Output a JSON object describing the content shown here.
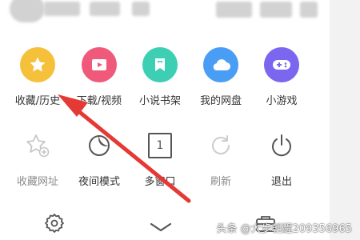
{
  "colors": {
    "favorites": "#f5c03a",
    "downloads": "#f05a7a",
    "novels": "#3ccfb4",
    "netdisk": "#4a9df5",
    "games": "#7b66f0",
    "annotation_arrow": "#e53935"
  },
  "menu": {
    "row1": [
      {
        "label": "收藏/历史",
        "icon": "star-icon"
      },
      {
        "label": "下载/视频",
        "icon": "download-video-icon"
      },
      {
        "label": "小说书架",
        "icon": "bookmark-book-icon"
      },
      {
        "label": "我的网盘",
        "icon": "cloud-icon"
      },
      {
        "label": "小游戏",
        "icon": "gamepad-icon"
      }
    ],
    "row2": [
      {
        "label": "收藏网址",
        "icon": "add-star-icon"
      },
      {
        "label": "夜间模式",
        "icon": "moon-icon"
      },
      {
        "label": "多窗口",
        "icon": "window-count-icon",
        "window_count": "1"
      },
      {
        "label": "刷新",
        "icon": "refresh-icon"
      },
      {
        "label": "退出",
        "icon": "power-icon"
      }
    ]
  },
  "bottom_bar": {
    "icons": [
      "settings-gear-icon",
      "collapse-chevron-icon",
      "toolbox-icon"
    ]
  },
  "watermark": "头条 @大步朝醒209356965"
}
